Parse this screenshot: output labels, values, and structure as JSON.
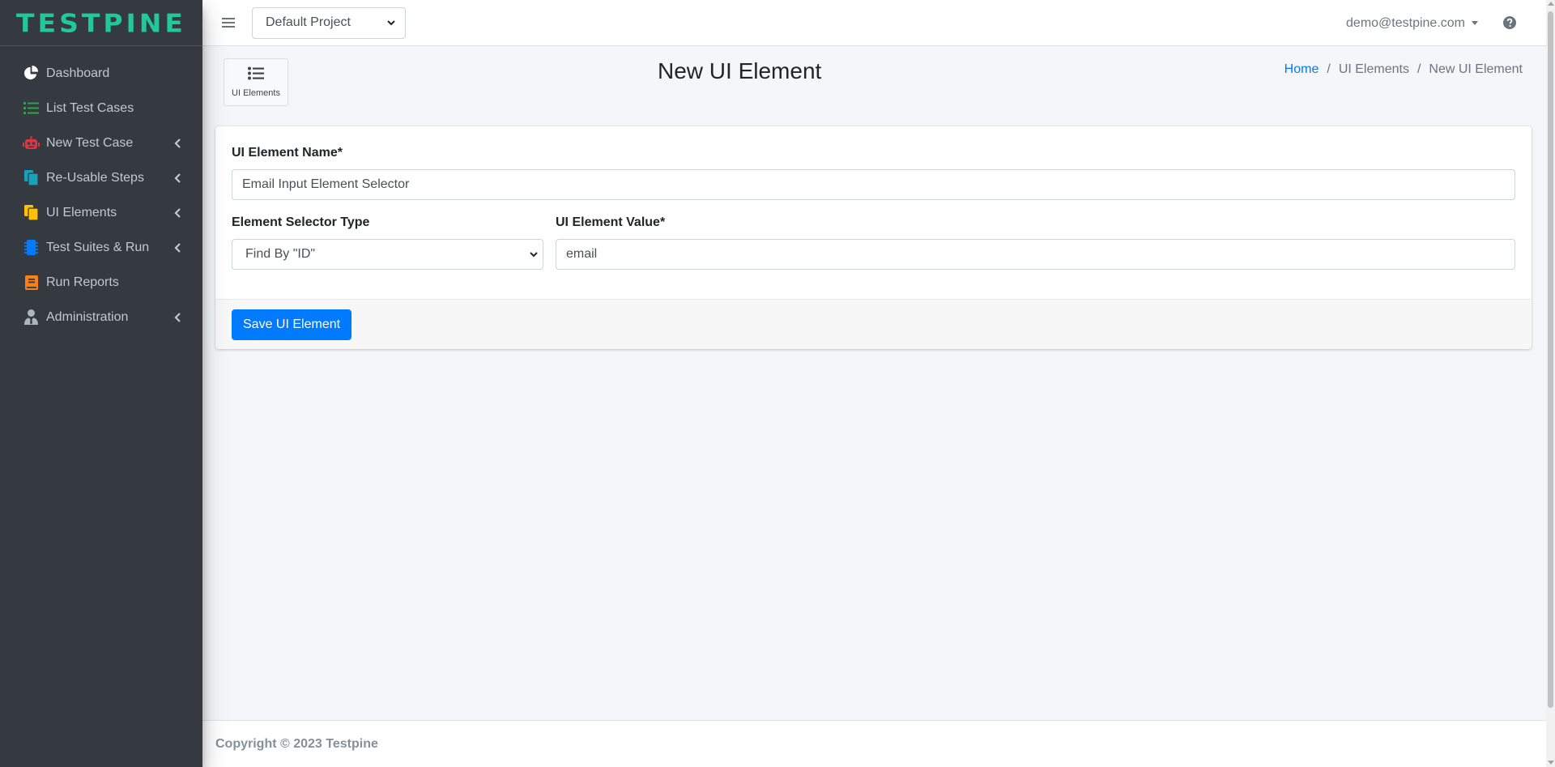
{
  "brand": {
    "name": "TESTPINE",
    "color": "#20c997"
  },
  "sidebar": {
    "items": [
      {
        "label": "Dashboard",
        "icon": "pie-chart-icon",
        "icon_color": "#ffffff",
        "has_submenu": false
      },
      {
        "label": "List Test Cases",
        "icon": "list-icon",
        "icon_color": "#28a745",
        "has_submenu": false
      },
      {
        "label": "New Test Case",
        "icon": "robot-icon",
        "icon_color": "#dc3545",
        "has_submenu": true
      },
      {
        "label": "Re-Usable Steps",
        "icon": "copy-icon",
        "icon_color": "#17a2b8",
        "has_submenu": true
      },
      {
        "label": "UI Elements",
        "icon": "copy-icon",
        "icon_color": "#ffc107",
        "has_submenu": true
      },
      {
        "label": "Test Suites & Run",
        "icon": "microchip-icon",
        "icon_color": "#007bff",
        "has_submenu": true
      },
      {
        "label": "Run Reports",
        "icon": "book-icon",
        "icon_color": "#fd7e14",
        "has_submenu": false
      },
      {
        "label": "Administration",
        "icon": "user-tie-icon",
        "icon_color": "#adb5bd",
        "has_submenu": true
      }
    ]
  },
  "topbar": {
    "project_select": {
      "value": "Default Project"
    },
    "user_email": "demo@testpine.com",
    "help_icon": "question-circle-icon"
  },
  "page": {
    "shortcut_label": "UI Elements",
    "title": "New UI Element",
    "breadcrumb": {
      "home": "Home",
      "section": "UI Elements",
      "current": "New UI Element",
      "separator": "/"
    }
  },
  "form": {
    "name_label": "UI Element Name*",
    "name_value": "Email Input Element Selector",
    "selector_type_label": "Element Selector Type",
    "selector_type_value": "Find By \"ID\"",
    "value_label": "UI Element Value*",
    "value_value": "email",
    "save_label": "Save UI Element"
  },
  "footer": {
    "copyright": "Copyright © 2023 Testpine"
  },
  "colors": {
    "primary": "#007bff",
    "sidebar_bg": "#343a40",
    "content_bg": "#f4f6f9"
  }
}
